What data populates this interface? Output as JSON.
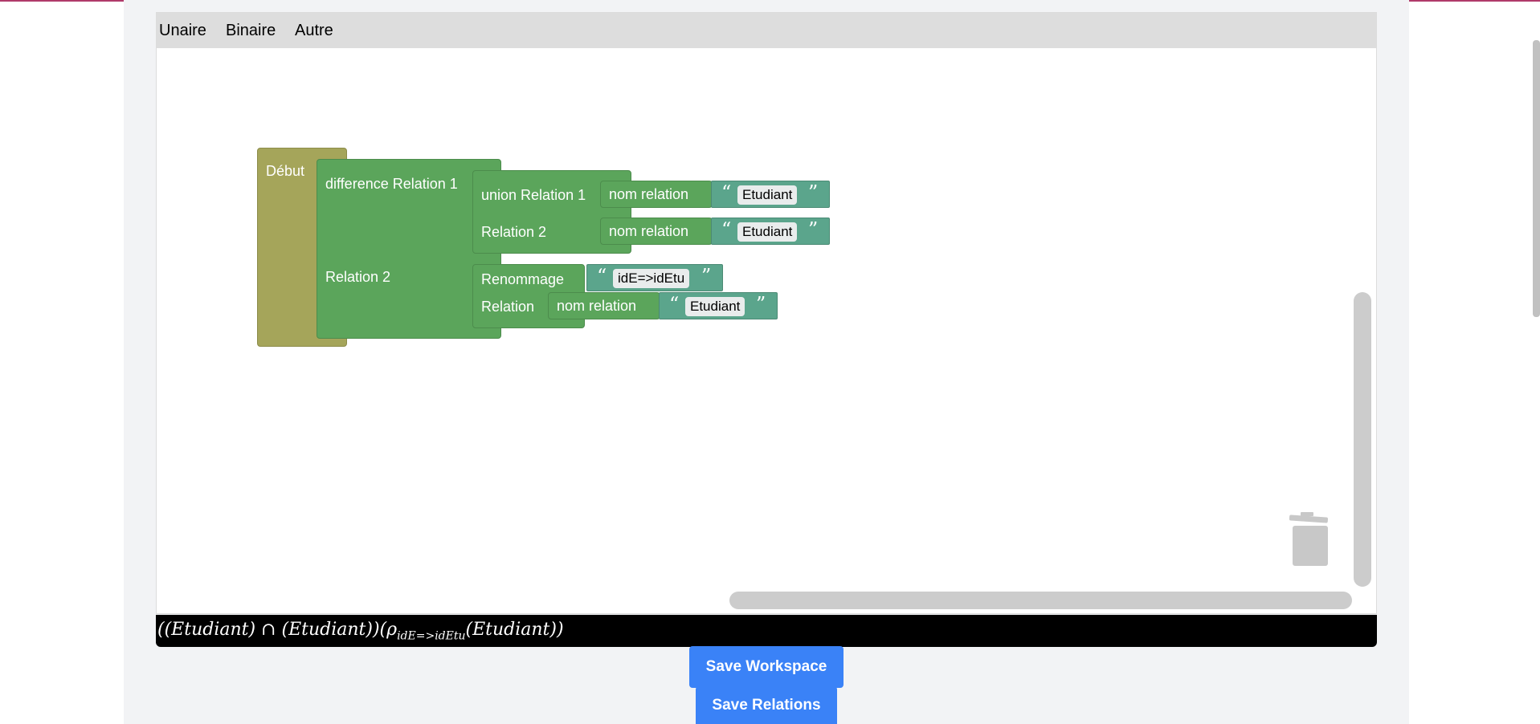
{
  "toolbox": {
    "categories": [
      "Unaire",
      "Binaire",
      "Autre"
    ]
  },
  "blocks": {
    "start_label": "Début",
    "difference_label": "difference Relation 1",
    "difference_relation2_label": "Relation 2",
    "union_label": "union Relation 1",
    "union_relation2_label": "Relation 2",
    "nom_relation_label": "nom relation",
    "rename_label": "Renommage",
    "rename_relation_label": "Relation",
    "open_quote": "“",
    "close_quote": "”",
    "union_rel1_value": "Etudiant",
    "union_rel2_value": "Etudiant",
    "rename_mapping_value": "idE=>idEtu",
    "rename_relation_value": "Etudiant"
  },
  "formula": {
    "part1": "((Etudiant) ∩ (Etudiant))(ρ",
    "subscript": "idE=>idEtu",
    "part2": "(Etudiant))"
  },
  "buttons": {
    "save_workspace": "Save Workspace",
    "save_relations": "Save Relations"
  },
  "colors": {
    "start_block": "#a5a55a",
    "logic_block": "#5ba55b",
    "text_block": "#5ba58c",
    "button": "#3a82f7",
    "formula_bg": "#000000"
  }
}
